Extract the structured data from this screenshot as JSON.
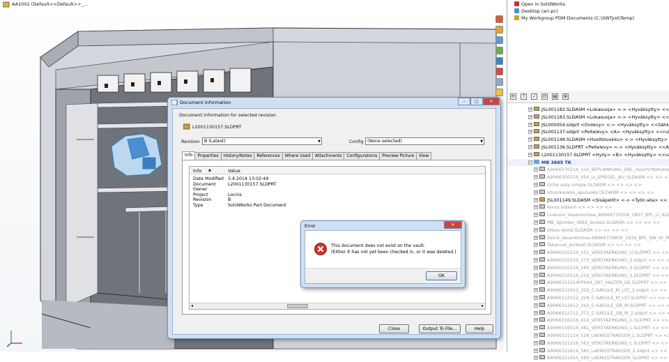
{
  "cad": {
    "title": "AA1002  (Default<<Default>>_...",
    "colors": {
      "frame": "#c9ccd3",
      "dark": "#4a4e57",
      "accent": "#4aa3e0"
    }
  },
  "right_panel": {
    "top_items": [
      {
        "label": "Open in SolidWorks"
      },
      {
        "label": "Desktop (ari-pc)"
      },
      {
        "label": "My Workgroup PDM Documents (C:\\SWTyot\\Temp)"
      }
    ],
    "tree": [
      {
        "text": "JSL001182.SLDASM <Lokasuoja> <-> <Hyväksytty> <<",
        "style": "normal"
      },
      {
        "text": "JSL001183.SLDASM <Lokasuoja> <-> <Hyväksytty> <<>",
        "style": "normal"
      },
      {
        "text": "JSL000054.sldprt <Ovilevy> <-> <Hyväksytty> <<Sähk",
        "style": "normal"
      },
      {
        "text": "JSL001137.sldprt <Peitelevy> <A> <Hyväksytty> <<rull",
        "style": "normal"
      },
      {
        "text": "JSL001148.SLDASM <Huoltoluukku> <-> <Hyväksytty> <",
        "style": "normal"
      },
      {
        "text": "JSL001136.SLDPRT <Peitelevy> <-> <Hyväksytty> <<A",
        "style": "normal"
      },
      {
        "text": "L2001130157.SLDPRT <Hylly> <B> <Hyväksytty> <<va",
        "style": "normal"
      },
      {
        "text": "MB 3665 TK",
        "style": "blue"
      },
      {
        "text": "A9066370216_120_BEPLANKUNG_DAC_beschriftetukset",
        "style": "grey"
      },
      {
        "text": "A9066300116_454_LI_SPIEGEL_AU_SLDASM <> <> <>",
        "style": "grey"
      },
      {
        "text": "Grille assy simple.SLDASM <> <> <> <>",
        "style": "grey"
      },
      {
        "text": "Istuinkaukko_apuluokki.SLDASM <> <> <> <>",
        "style": "grey"
      },
      {
        "text": "JSL001149.SLDASM <Sisäpellit> <-> <Työn alla> <<",
        "style": "normal"
      },
      {
        "text": "Koulu.sldasm <> <> <> <>",
        "style": "grey"
      },
      {
        "text": "Liukuovi_Vasenkorkea_A9066730206_1807_BPL_LI_A2L",
        "style": "grey"
      },
      {
        "text": "MB_Sprinter_3665_korkea.SLDASM <> <> <> <>",
        "style": "grey"
      },
      {
        "text": "Oikea seinä.SLDASM <> <> <> <>",
        "style": "grey"
      },
      {
        "text": "Seinä_VasenKorkea.A9066370809_1634_BPL_SW_HI_M_",
        "style": "grey"
      },
      {
        "text": "Takaovet_korkeat.SLDASM <> <> <> <>",
        "style": "grey"
      },
      {
        "text": "A9066310216_151_VERSTAERKUNG_U.SLDPRT <> <> <>",
        "style": "grey"
      },
      {
        "text": "A9066310216_170_VERSTAERKUNG_S.sldprt <> <> <>",
        "style": "grey"
      },
      {
        "text": "A9066310216_185_VERSTAERKUNG_S.SLDPRT <> <> <>",
        "style": "grey"
      },
      {
        "text": "A9066310516_219_VERSTAERKUNG_S.SLDPRT <> <> <>",
        "style": "grey"
      },
      {
        "text": "A9066311014FP004_287_HALTER_GE.SLDPRT <> <> <>",
        "style": "grey"
      },
      {
        "text": "A9066312412_320_C-SAEULE_M_LST_2.sldprt <> <> <>",
        "style": "grey"
      },
      {
        "text": "A9066312512_328_C-SAEULE_M_LST.SLDPRT <> <> <>",
        "style": "grey"
      },
      {
        "text": "A9066312612_342_C-SAEULE_OB_M.SLDPRT <> <> <>",
        "style": "grey"
      },
      {
        "text": "A9066312712_372_C-SAEULE_OB_M_2.sldprt <> <> <>",
        "style": "grey"
      },
      {
        "text": "A9066316016_410_VERSTAERKUNG_C.SLDPRT <> <> <>",
        "style": "grey"
      },
      {
        "text": "A9066316016_481_VERSTAERKUNG_L.SLDPRT <> <> <>",
        "style": "grey"
      },
      {
        "text": "A9066321114_526_LAENGSTRAEGER_L.SLDPRT <> <> <>",
        "style": "grey"
      },
      {
        "text": "A9066321216_562_VERSTAERKUNG_L.SLDPRT <> <> <>",
        "style": "grey"
      },
      {
        "text": "A9066321814_585_LAENGSTRAEGER_2.sldprt <> <> <>",
        "style": "grey"
      },
      {
        "text": "A9066321914_590_LAENGSTRAEGER_SLDPRT <> <> <>",
        "style": "grey"
      }
    ]
  },
  "doc_info": {
    "title": "Document Information",
    "header": "Document information for selected revision",
    "filename": "L2001130157.SLDPRT",
    "revision_label": "Revision",
    "revision_value": "B (Latest)",
    "config_label": "Config",
    "config_value": "(None selected)",
    "tabs": [
      "Info",
      "Properties",
      "History/Notes",
      "References",
      "Where Used",
      "Attachments",
      "Configurations",
      "Preview Picture",
      "View"
    ],
    "col_info": "Info",
    "col_value": "Value",
    "rows": [
      {
        "k": "Date Modified",
        "v": "3.4.2014 13:02:49"
      },
      {
        "k": "Document",
        "v": "L2001130157.SLDPRT"
      },
      {
        "k": "Owner",
        "v": ""
      },
      {
        "k": "Project",
        "v": "Locnis"
      },
      {
        "k": "Revision",
        "v": "B"
      },
      {
        "k": "Type",
        "v": "SolidWorks Part Document"
      }
    ],
    "buttons": {
      "close": "Close",
      "output": "Output To File...",
      "help": "Help"
    }
  },
  "error": {
    "title": "Error",
    "line1": "This document does not exist on the vault.",
    "line2": "(Either it has not yet been checked in, or it was deleted.)",
    "ok": "OK"
  }
}
